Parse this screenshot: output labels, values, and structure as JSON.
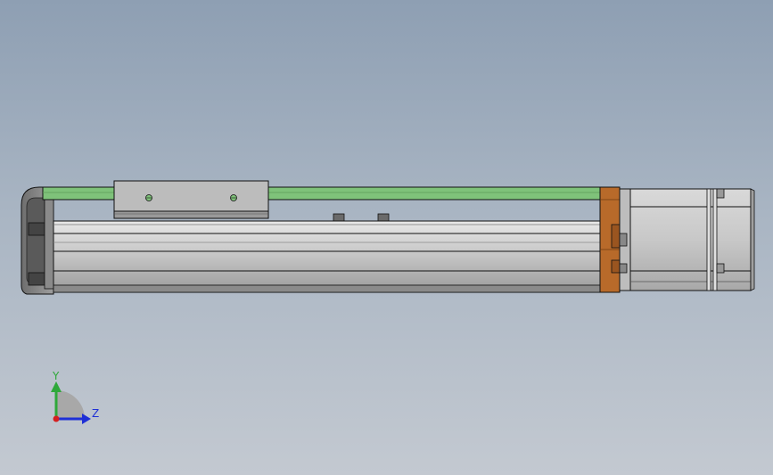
{
  "viewport": {
    "background_top": "#8e9fb3",
    "background_bottom": "#c3c9d1"
  },
  "model": {
    "rail_color": "#7fc27a",
    "end_plate_color": "#b86a2a",
    "body_color": "#bdbdbd",
    "edge_color": "#111111"
  },
  "triad": {
    "y_label": "Y",
    "z_label": "Z",
    "y_color": "#2ea83a",
    "z_color": "#1e2fd6",
    "x_color": "#d42020"
  }
}
